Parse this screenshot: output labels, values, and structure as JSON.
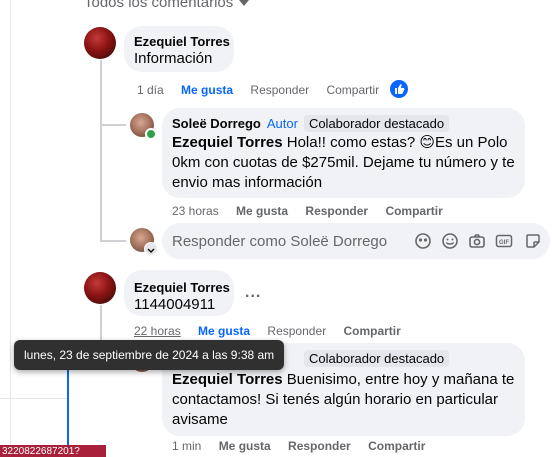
{
  "header": {
    "title": "Todos los comentarios"
  },
  "comment1": {
    "author": "Ezequiel Torres",
    "text": "Información",
    "time": "1 día",
    "like": "Me gusta",
    "reply": "Responder",
    "share": "Compartir"
  },
  "reply1": {
    "author": "Soleë Dorrego",
    "role": "Autor",
    "badge": "Colaborador destacado",
    "mention": "Ezequiel Torres",
    "text": " Hola!! como estas? 😊Es un Polo 0km con cuotas de $275mil. Dejame tu número y te envio mas información",
    "time": "23 horas",
    "like": "Me gusta",
    "reply": "Responder",
    "share": "Compartir"
  },
  "reply_box": {
    "placeholder": "Responder como Soleë Dorrego"
  },
  "comment2": {
    "author": "Ezequiel Torres",
    "text": "1144004911",
    "more": "...",
    "time": "22 horas",
    "like": "Me gusta",
    "reply": "Responder",
    "share": "Compartir"
  },
  "reply2": {
    "badge": "Colaborador destacado",
    "mention": "Ezequiel Torres",
    "text": " Buenisimo, entre hoy y mañana te contactamos! Si tenés algún horario en particular avisame",
    "time": "1 min",
    "like": "Me gusta",
    "reply": "Responder",
    "share": "Compartir"
  },
  "tooltip": {
    "text": "lunes, 23 de septiembre de 2024 a las 9:38 am"
  },
  "bottom_badge": {
    "text": "3220822687201?"
  },
  "colors": {
    "blue": "#0866ff",
    "meta": "#65676b",
    "bubble": "#f0f2f5"
  }
}
